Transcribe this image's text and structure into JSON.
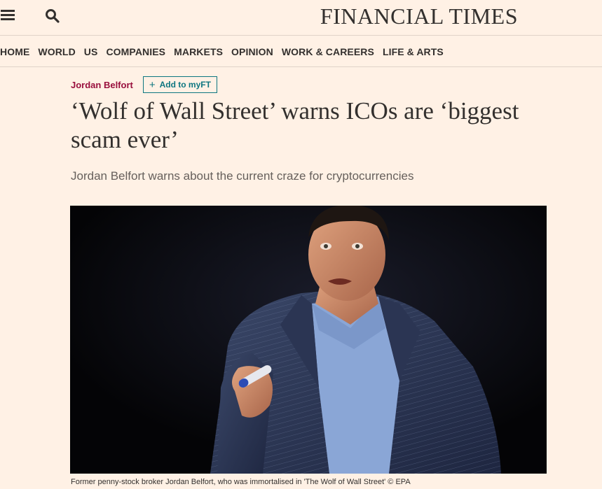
{
  "header": {
    "menu_icon": "hamburger-icon",
    "search_icon": "search-icon",
    "logo_text": "FINANCIAL TIMES"
  },
  "nav": {
    "items": [
      "HOME",
      "WORLD",
      "US",
      "COMPANIES",
      "MARKETS",
      "OPINION",
      "WORK & CAREERS",
      "LIFE & ARTS"
    ]
  },
  "article": {
    "topic": "Jordan Belfort",
    "myft_button": "Add to myFT",
    "myft_icon": "plus-icon",
    "headline": "‘Wolf of Wall Street’ warns ICOs are ‘biggest scam ever’",
    "standfirst": "Jordan Belfort warns about the current craze for cryptocurrencies",
    "image_caption": "Former penny-stock broker Jordan Belfort, who was immortalised in 'The Wolf of Wall Street' © EPA"
  },
  "colors": {
    "background": "#fff1e5",
    "topic_link": "#990f3d",
    "myft_accent": "#0d7680",
    "text": "#33302e"
  }
}
